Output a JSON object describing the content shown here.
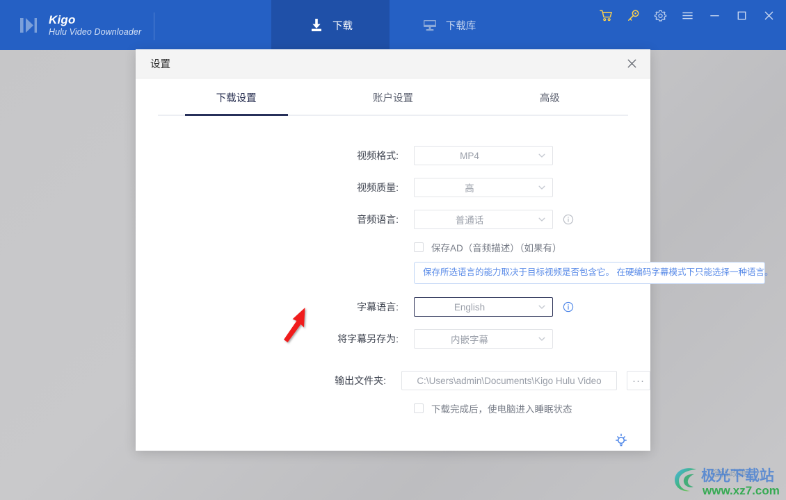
{
  "window": {
    "brand_name": "Kigo",
    "brand_subtitle": "Hulu Video Downloader",
    "logo_icon": "kigo-play-logo",
    "nav": [
      {
        "label": "下载",
        "icon": "download-icon",
        "active": true
      },
      {
        "label": "下载库",
        "icon": "monitor-library-icon",
        "active": false
      }
    ],
    "controls": [
      {
        "name": "cart-icon",
        "color": "#ffd24a"
      },
      {
        "name": "key-icon",
        "color": "#ffd24a"
      },
      {
        "name": "gear-icon",
        "color": "#cfdcf2"
      },
      {
        "name": "menu-icon",
        "color": "#cfdcf2"
      },
      {
        "name": "minimize-icon",
        "color": "#cfdcf2"
      },
      {
        "name": "maximize-icon",
        "color": "#cfdcf2"
      },
      {
        "name": "close-icon",
        "color": "#cfdcf2"
      }
    ],
    "titlebar_color": "#2560c4",
    "active_tab_color": "#1f50a8"
  },
  "dialog": {
    "title": "设置",
    "close_icon": "close-icon",
    "tabs": [
      {
        "label": "下载设置",
        "active": true
      },
      {
        "label": "账户设置",
        "active": false
      },
      {
        "label": "高级",
        "active": false
      }
    ],
    "accent_underline_color": "#27305a",
    "fields": {
      "video_format": {
        "label": "视频格式:",
        "value": "MP4"
      },
      "video_quality": {
        "label": "视频质量:",
        "value": "高"
      },
      "audio_language": {
        "label": "音频语言:",
        "value": "普通话",
        "info_icon": "info-icon"
      },
      "save_ad_checkbox": {
        "label": "保存AD（音频描述）（如果有）",
        "checked": false
      },
      "subtitle_language": {
        "label": "字幕语言:",
        "value": "English",
        "info_icon": "info-icon",
        "focused": true
      },
      "save_subtitle_as": {
        "label": "将字幕另存为:",
        "value": "内嵌字幕"
      },
      "output_folder": {
        "label": "输出文件夹:",
        "value": "C:\\Users\\admin\\Documents\\Kigo Hulu Video",
        "browse_label": "···"
      },
      "sleep_checkbox": {
        "label": "下载完成后，使电脑进入睡眠状态",
        "checked": false
      }
    },
    "hint": "保存所选语言的能力取决于目标视频是否包含它。 在硬编码字幕模式下只能选择一种语言。",
    "tip_button_icon": "lightbulb-icon"
  },
  "annotation": {
    "arrow_color": "#f01b1b",
    "arrow_points_to": "subtitle-language-select"
  },
  "watermark": {
    "site_name": "极光下载站",
    "site_url": "www.xz7.com",
    "overlay_text": "隐私政策"
  }
}
